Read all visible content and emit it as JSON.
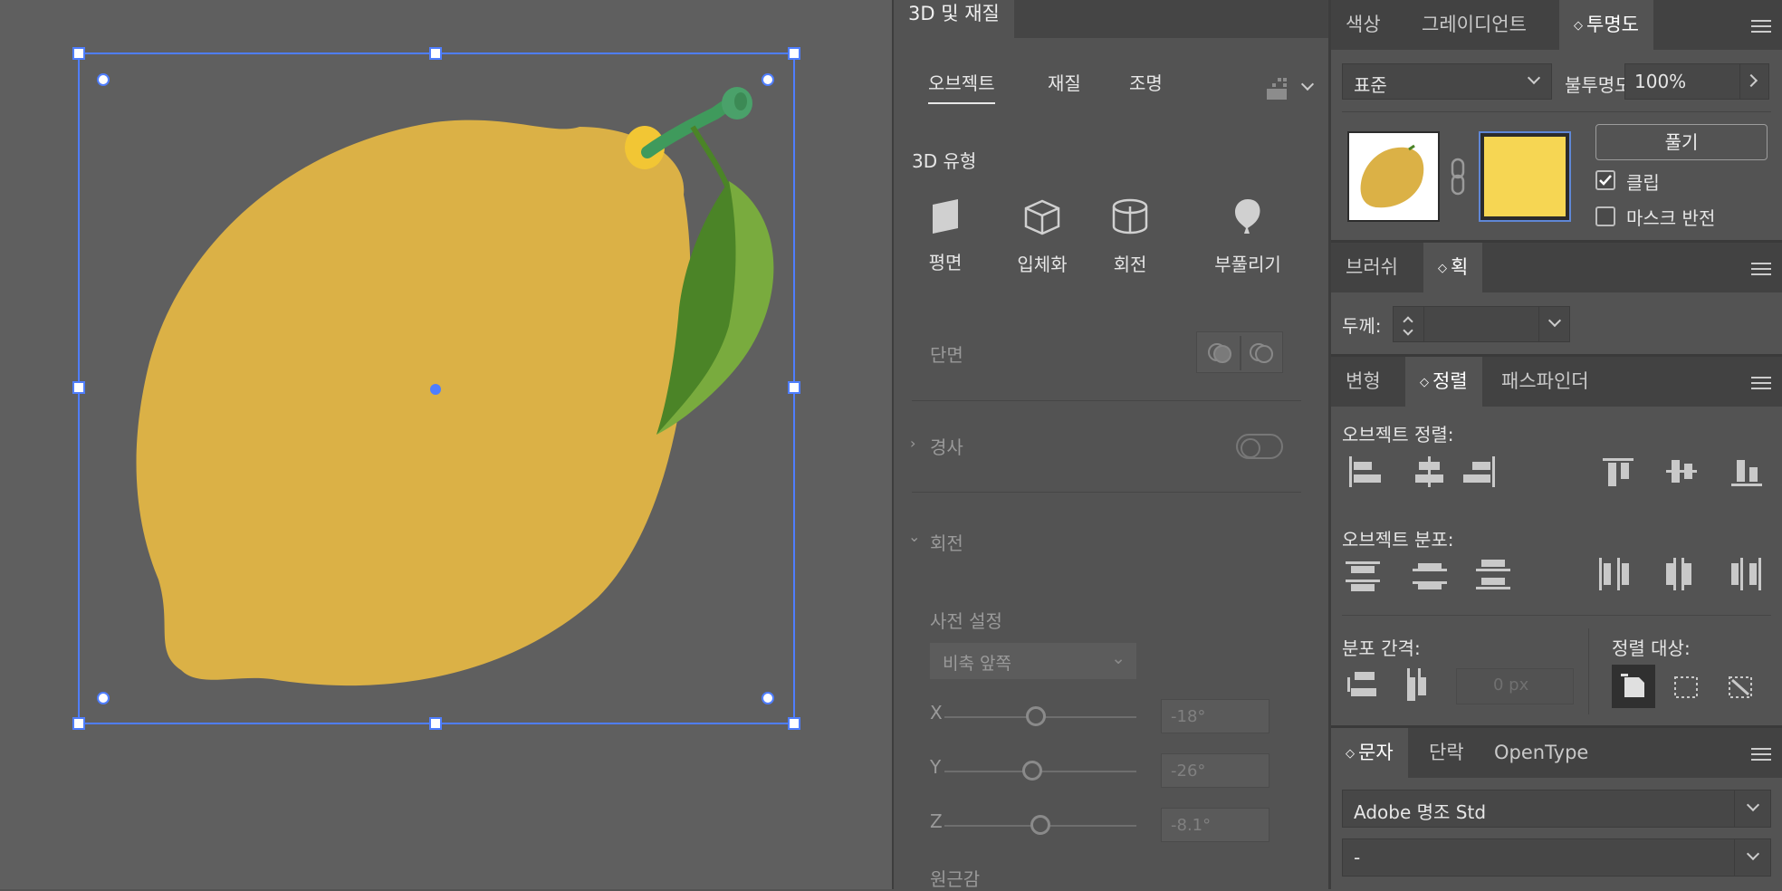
{
  "colors": {
    "canvas_bg": "#5f5f5f",
    "selection": "#4f7eff",
    "lemon": "#dbb146",
    "leaf_dark": "#4b8427",
    "leaf_light": "#79ab3e",
    "stem": "#3f9a5c",
    "mask_yellow": "#f6d653"
  },
  "panel_3d": {
    "title": "3D 및 재질",
    "tabs": [
      "오브젝트",
      "재질",
      "조명"
    ],
    "type_heading": "3D 유형",
    "types": [
      {
        "label": "평면",
        "icon": "plane-icon"
      },
      {
        "label": "입체화",
        "icon": "extrude-icon"
      },
      {
        "label": "회전",
        "icon": "revolve-icon"
      },
      {
        "label": "부풀리기",
        "icon": "inflate-icon"
      }
    ],
    "cap_label": "단면",
    "bevel_label": "경사",
    "rotation_label": "회전",
    "preset_label": "사전 설정",
    "preset_value": "비축 앞쪽",
    "x_label": "X",
    "x_value": "-18°",
    "y_label": "Y",
    "y_value": "-26°",
    "z_label": "Z",
    "z_value": "-8.1°",
    "perspective_label": "원근감"
  },
  "transparency_panel": {
    "tabs": [
      "색상",
      "그레이디언트",
      "투명도"
    ],
    "blend_mode": "표준",
    "opacity_label": "불투명도:",
    "opacity_value": "100%",
    "release_button": "풀기",
    "clip_label": "클립",
    "clip_checked": true,
    "invert_label": "마스크 반전",
    "invert_checked": false
  },
  "stroke_panel": {
    "tabs": [
      "브러쉬",
      "획"
    ],
    "weight_label": "두께:"
  },
  "align_panel": {
    "tabs": [
      "변형",
      "정렬",
      "패스파인더"
    ],
    "align_objects_label": "오브젝트 정렬:",
    "distribute_objects_label": "오브젝트 분포:",
    "distribute_spacing_label": "분포 간격:",
    "spacing_value": "0 px",
    "align_to_label": "정렬 대상:"
  },
  "character_panel": {
    "tabs": [
      "문자",
      "단락",
      "OpenType"
    ],
    "font_family": "Adobe 명조 Std",
    "font_style": "-"
  }
}
